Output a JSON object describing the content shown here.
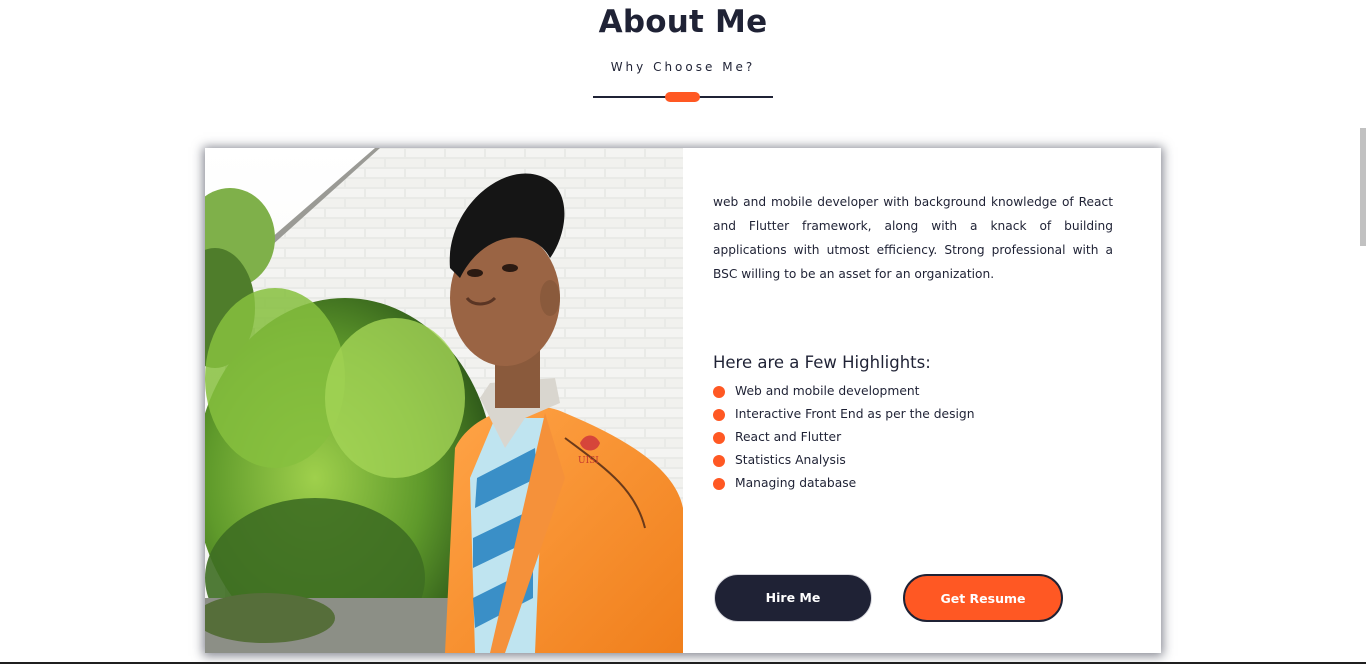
{
  "section": {
    "title": "About Me",
    "subtitle": "Why Choose Me?"
  },
  "about": {
    "intro": "web and mobile developer with background knowledge of React and Flutter framework, along with a knack of building applications with utmost efficiency. Strong professional with a BSC willing to be an asset for an organization.",
    "highlights_title": "Here are a Few Highlights:",
    "highlights": [
      "Web and mobile development",
      "Interactive Front End as per the design",
      "React and Flutter",
      "Statistics Analysis",
      "Managing database"
    ],
    "photo_badge": "UISI"
  },
  "buttons": {
    "hire": "Hire Me",
    "resume": "Get Resume"
  },
  "colors": {
    "accent": "#ff5823",
    "dark": "#1f2235"
  }
}
